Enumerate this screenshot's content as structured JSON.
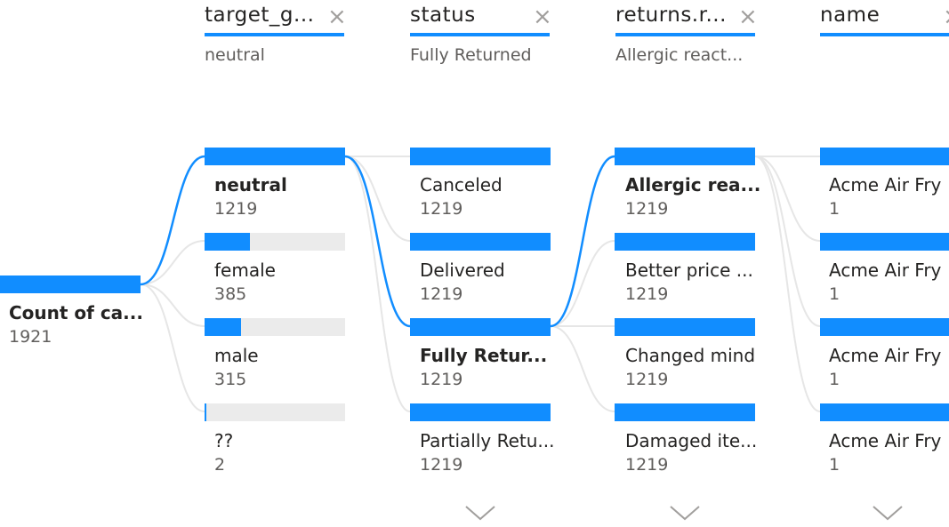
{
  "root": {
    "label": "Count of ca...",
    "value": "1921"
  },
  "levels": [
    {
      "header": "target_g...",
      "selection": "neutral",
      "nodes": [
        {
          "label": "neutral",
          "value": "1219",
          "fill": 1.0,
          "bold": true
        },
        {
          "label": "female",
          "value": "385",
          "fill": 0.32,
          "bold": false
        },
        {
          "label": "male",
          "value": "315",
          "fill": 0.26,
          "bold": false
        },
        {
          "label": "??",
          "value": "2",
          "fill": 0.01,
          "bold": false
        }
      ]
    },
    {
      "header": "status",
      "selection": "Fully Returned",
      "nodes": [
        {
          "label": "Canceled",
          "value": "1219",
          "fill": 1.0,
          "bold": false
        },
        {
          "label": "Delivered",
          "value": "1219",
          "fill": 1.0,
          "bold": false
        },
        {
          "label": "Fully Retur...",
          "value": "1219",
          "fill": 1.0,
          "bold": true
        },
        {
          "label": "Partially Retu...",
          "value": "1219",
          "fill": 1.0,
          "bold": false
        }
      ]
    },
    {
      "header": "returns.r...",
      "selection": "Allergic react...",
      "nodes": [
        {
          "label": "Allergic rea...",
          "value": "1219",
          "fill": 1.0,
          "bold": true
        },
        {
          "label": "Better price ...",
          "value": "1219",
          "fill": 1.0,
          "bold": false
        },
        {
          "label": "Changed mind",
          "value": "1219",
          "fill": 1.0,
          "bold": false
        },
        {
          "label": "Damaged ite...",
          "value": "1219",
          "fill": 1.0,
          "bold": false
        }
      ]
    },
    {
      "header": "name",
      "selection": "",
      "nodes": [
        {
          "label": "Acme Air Fry",
          "value": "1",
          "fill": 1.0,
          "bold": false
        },
        {
          "label": "Acme Air Fry",
          "value": "1",
          "fill": 1.0,
          "bold": false
        },
        {
          "label": "Acme Air Fry",
          "value": "1",
          "fill": 1.0,
          "bold": false
        },
        {
          "label": "Acme Air Fry",
          "value": "1",
          "fill": 1.0,
          "bold": false
        }
      ]
    }
  ],
  "icons": {
    "close": "close-icon",
    "expand": "chevron-down-icon"
  },
  "colors": {
    "accent": "#118dff",
    "track": "#ebebeb",
    "link": "#e8e8e8",
    "text": "#252423",
    "muted": "#605e5c"
  }
}
